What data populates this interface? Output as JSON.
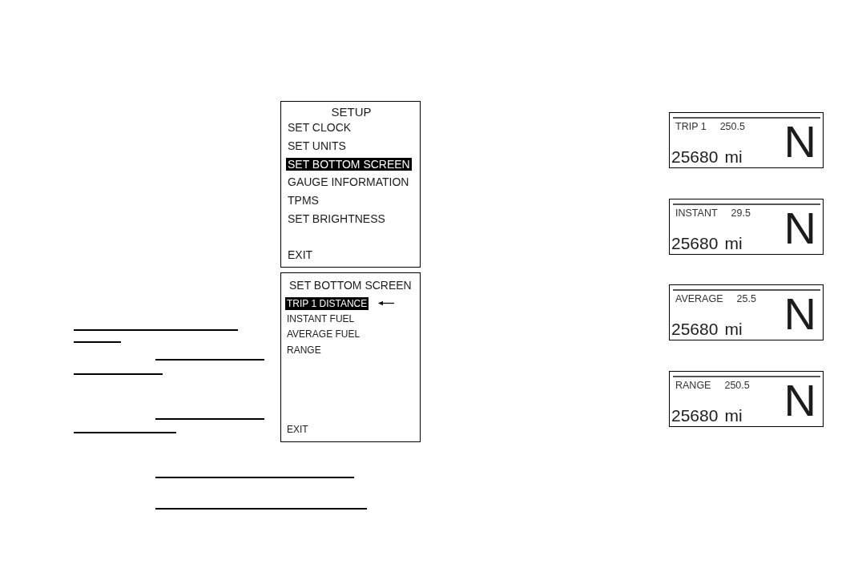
{
  "left_blanks": [
    {
      "kind": "margin"
    },
    {
      "kind": "margin"
    },
    {
      "kind": "indented"
    },
    {
      "kind": "margin"
    },
    {
      "kind": "indented"
    },
    {
      "kind": "margin"
    }
  ],
  "setup_menu": {
    "title": "SETUP",
    "items": [
      {
        "label": "SET CLOCK",
        "selected": false
      },
      {
        "label": "SET UNITS",
        "selected": false
      },
      {
        "label": "SET BOTTOM SCREEN",
        "selected": true
      },
      {
        "label": "GAUGE INFORMATION",
        "selected": false
      },
      {
        "label": "TPMS",
        "selected": false
      },
      {
        "label": "SET BRIGHTNESS",
        "selected": false
      }
    ],
    "exit": {
      "label": "EXIT",
      "selected": false
    }
  },
  "bottom_screen_menu": {
    "title": "SET BOTTOM SCREEN",
    "items": [
      {
        "label": "TRIP 1 DISTANCE",
        "selected": true
      },
      {
        "label": "INSTANT FUEL",
        "selected": false
      },
      {
        "label": "AVERAGE FUEL",
        "selected": false
      },
      {
        "label": "RANGE",
        "selected": false
      }
    ],
    "exit": {
      "label": "EXIT",
      "selected": false
    }
  },
  "displays": [
    {
      "label": "TRIP 1",
      "value": "250.5",
      "odometer": "25680",
      "unit": "mi",
      "gear": "N"
    },
    {
      "label": "INSTANT",
      "value": "29.5",
      "odometer": "25680",
      "unit": "mi",
      "gear": "N"
    },
    {
      "label": "AVERAGE",
      "value": "25.5",
      "odometer": "25680",
      "unit": "mi",
      "gear": "N"
    },
    {
      "label": "RANGE",
      "value": "250.5",
      "odometer": "25680",
      "unit": "mi",
      "gear": "N"
    }
  ],
  "bottom_blanks": [
    {
      "kind": "indented"
    },
    {
      "kind": "indented"
    }
  ]
}
